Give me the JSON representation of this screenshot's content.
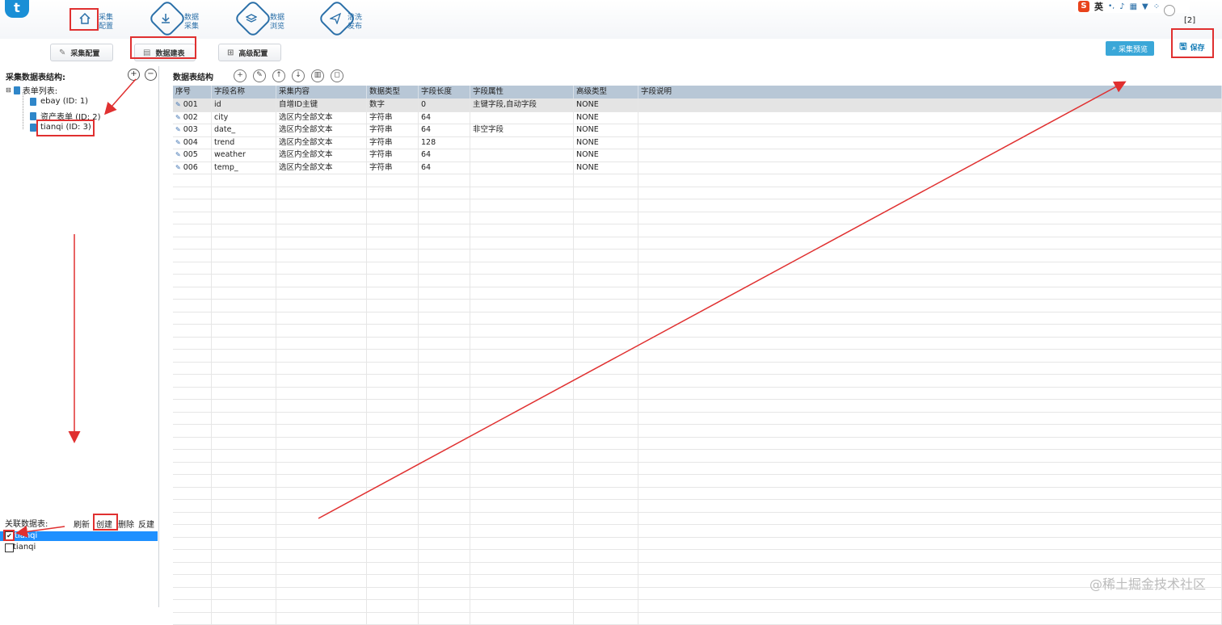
{
  "header": {
    "logo_text": "t",
    "nav": [
      {
        "label_line1": "采集",
        "label_line2": "配置",
        "icon": "home-icon"
      },
      {
        "label_line1": "数据",
        "label_line2": "采集",
        "icon": "download-icon"
      },
      {
        "label_line1": "数据",
        "label_line2": "浏览",
        "icon": "layers-icon"
      },
      {
        "label_line1": "清洗",
        "label_line2": "发布",
        "icon": "send-icon"
      }
    ],
    "ime_label": "英",
    "counter": "[2]"
  },
  "tabs": [
    {
      "label": "采集配置",
      "icon": "edit-icon"
    },
    {
      "label": "数据建表",
      "icon": "document-icon"
    },
    {
      "label": "高级配置",
      "icon": "grid-icon"
    }
  ],
  "actions": {
    "preview_label": "采集预览",
    "save_label": "保存"
  },
  "left": {
    "structure_title": "采集数据表结构:",
    "tree_root": "表单列表:",
    "tables": [
      "ebay (ID: 1)",
      "资产表单 (ID: 2)",
      "tianqi (ID: 3)"
    ],
    "related_title": "关联数据表:",
    "related_actions": [
      "刷新",
      "创建",
      "删除",
      "反建"
    ],
    "related_items": [
      {
        "label": "tianqi",
        "checked": true,
        "selected": true
      },
      {
        "label": "tianqi",
        "checked": false,
        "selected": false
      }
    ]
  },
  "main": {
    "title": "数据表结构",
    "columns": [
      "序号",
      "字段名称",
      "采集内容",
      "数据类型",
      "字段长度",
      "字段属性",
      "高级类型",
      "字段说明"
    ],
    "rows": [
      [
        "001",
        "id",
        "自增ID主键",
        "数字",
        "0",
        "主键字段,自动字段",
        "NONE",
        ""
      ],
      [
        "002",
        "city",
        "选区内全部文本",
        "字符串",
        "64",
        "",
        "NONE",
        ""
      ],
      [
        "003",
        "date_",
        "选区内全部文本",
        "字符串",
        "64",
        "非空字段",
        "NONE",
        ""
      ],
      [
        "004",
        "trend",
        "选区内全部文本",
        "字符串",
        "128",
        "",
        "NONE",
        ""
      ],
      [
        "005",
        "weather",
        "选区内全部文本",
        "字符串",
        "64",
        "",
        "NONE",
        ""
      ],
      [
        "006",
        "temp_",
        "选区内全部文本",
        "字符串",
        "64",
        "",
        "NONE",
        ""
      ]
    ]
  },
  "watermark": "@稀土掘金技术社区",
  "colors": {
    "accent": "#2a6fa8",
    "annotation": "#e03030",
    "selection": "#1e90ff",
    "grid_header": "#b8c7d6"
  }
}
